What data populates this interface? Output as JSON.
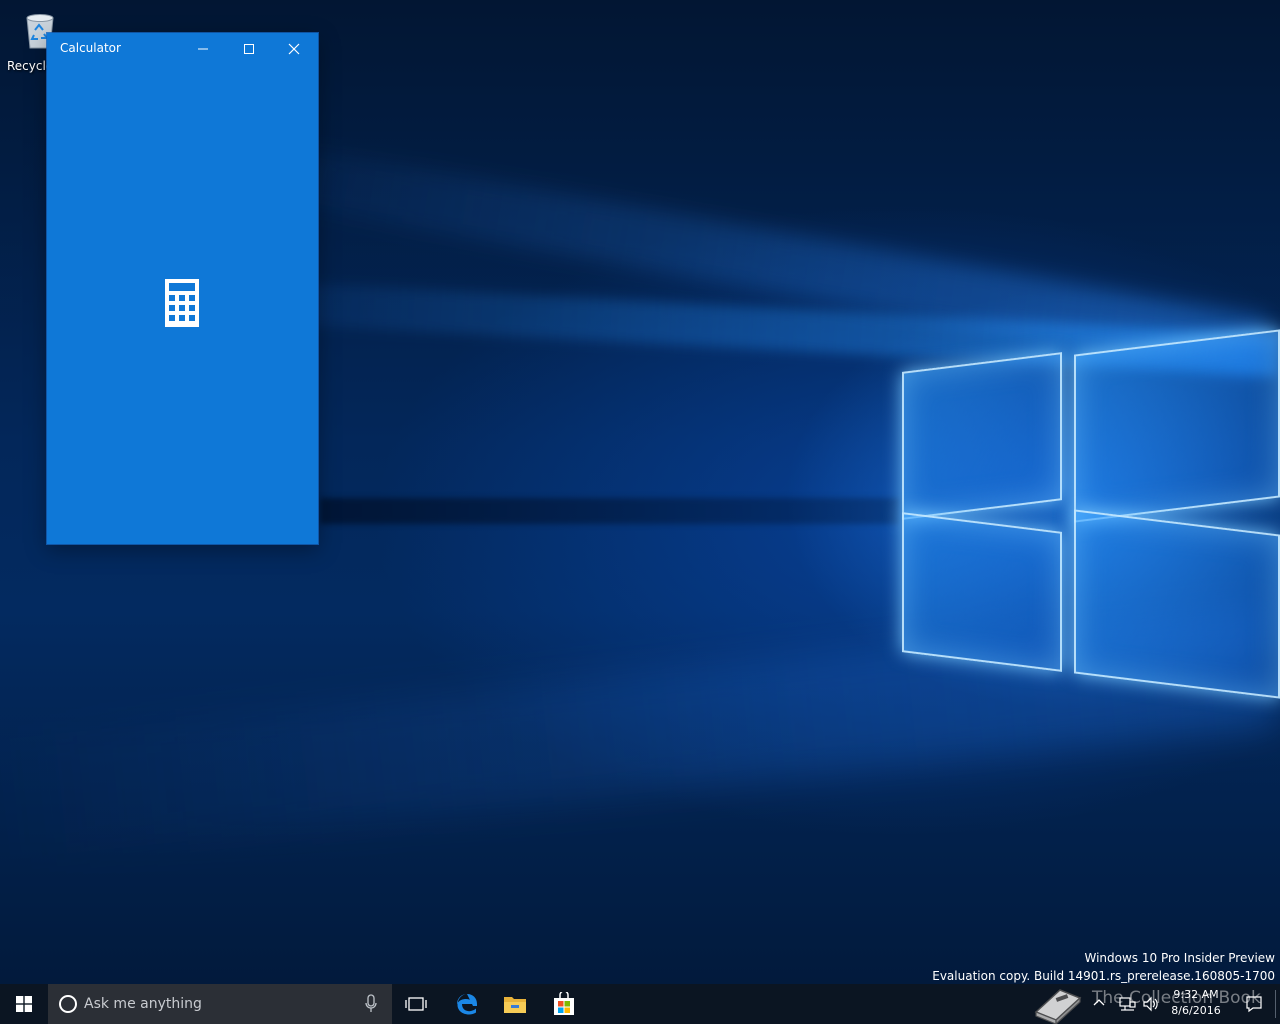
{
  "desktop": {
    "icons": [
      {
        "label": "Recycle Bin",
        "icon": "recycle-bin-icon"
      }
    ]
  },
  "calculator_window": {
    "title": "Calculator",
    "controls": {
      "minimize": "minimize-icon",
      "maximize": "maximize-icon",
      "close": "close-icon"
    },
    "splash_icon": "calculator-icon",
    "background_color": "#0f78d7"
  },
  "watermark": {
    "line1": "Windows 10 Pro Insider Preview",
    "line2": "Evaluation copy. Build 14901.rs_prerelease.160805-1700"
  },
  "taskbar": {
    "background_color": "#0b1522",
    "start_icon": "windows-logo-icon",
    "search": {
      "placeholder": "Ask me anything",
      "cortana_icon": "cortana-circle-icon",
      "mic_icon": "microphone-icon"
    },
    "pinned": [
      {
        "name": "Task View",
        "icon": "task-view-icon"
      },
      {
        "name": "Microsoft Edge",
        "icon": "edge-icon"
      },
      {
        "name": "File Explorer",
        "icon": "folder-icon"
      },
      {
        "name": "Store",
        "icon": "store-icon"
      }
    ],
    "tray": {
      "logo_text": "The Collection Book",
      "time": "9:32 AM",
      "date": "8/6/2016",
      "icons": [
        "chevron-up-icon",
        "network-icon",
        "volume-icon",
        "action-center-icon"
      ]
    }
  }
}
